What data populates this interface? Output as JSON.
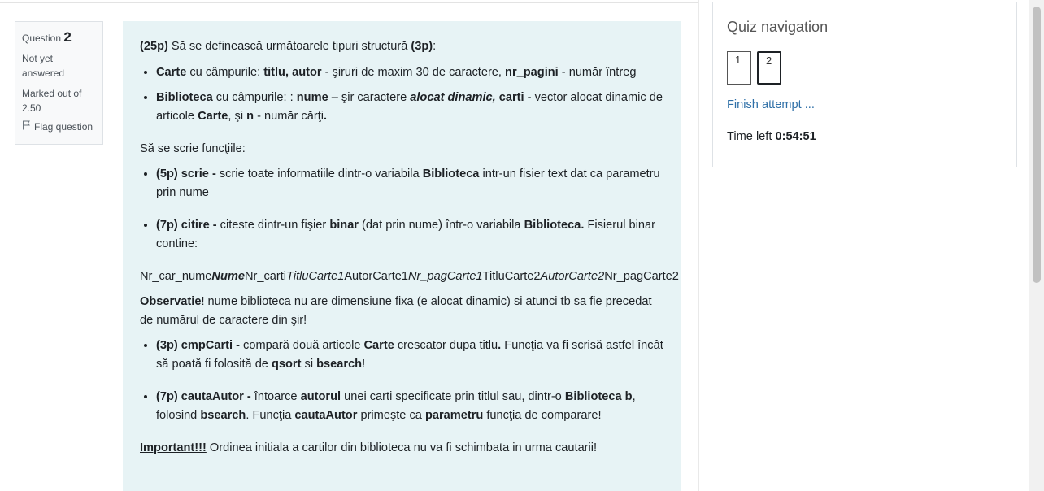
{
  "question_info": {
    "label": "Question",
    "number": "2",
    "state": "Not yet answered",
    "marked_prefix": "Marked out of",
    "marked_value": "2.50",
    "flag_label": "Flag question"
  },
  "question": {
    "intro_points": "(25p)",
    "intro_text": " Să se definească următoarele tipuri structură ",
    "intro_points2": "(3p)",
    "intro_end": ":",
    "struct_items": [
      {
        "b1": "Carte",
        "t1": " cu câmpurile: ",
        "b2": "titlu, autor",
        "t2": " - şiruri de maxim 30 de caractere, ",
        "b3": "nr_pagini",
        "t3": " - număr întreg"
      },
      {
        "b1": "Biblioteca",
        "t1": " cu câmpurile: : ",
        "b2": "nume",
        "t2": " – şir caractere ",
        "bi": "alocat dinamic,",
        "b3": " carti",
        "t3": " - vector alocat dinamic de articole ",
        "b4": "Carte",
        "t4": ", şi ",
        "b5": "n",
        "t5": " - număr cărţi",
        "b6": "."
      }
    ],
    "functions_heading": "Să se scrie funcţiile:",
    "fn1": {
      "b": "(5p) scrie -",
      "t1": " scrie toate informatiile dintr-o variabila ",
      "b2": "Biblioteca",
      "t2": " intr-un fisier text dat ca parametru prin nume"
    },
    "fn2": {
      "b": "(7p) citire -",
      "t1": " citeste dintr-un fişier ",
      "b2": "binar",
      "t2": " (dat prin nume) într-o variabila ",
      "b3": "Biblioteca.",
      "t3": " Fisierul binar contine:"
    },
    "format_line": {
      "p1": "Nr_car_nume",
      "p2": "Nume",
      "p3": "Nr_carti",
      "p4": "TitluCarte1",
      "p5": "AutorCarte1",
      "p6": "Nr_pagCarte1",
      "p7": "TitluCarte2",
      "p8": "AutorCarte2",
      "p9": "Nr_pagCarte2"
    },
    "observatie": {
      "u": "Observatie",
      "t": "! nume biblioteca nu are dimensiune fixa (e alocat dinamic) si atunci tb sa fie precedat de numărul de caractere din şir!"
    },
    "fn3": {
      "b": "(3p) cmpCarti -",
      "t1": " compară două articole ",
      "b2": "Carte",
      "t2": " crescator dupa titlu",
      "b3": ".",
      "t3": " Funcţia va fi scrisă astfel încât să poată fi folosită de ",
      "b4": "qsort",
      "t4": " si ",
      "b5": "bsearch",
      "t5": "!"
    },
    "fn4": {
      "b": "(7p) cautaAutor -",
      "t1": " întoarce ",
      "b2": "autorul",
      "t2": " unei carti specificate prin titlul sau, dintr-o ",
      "b3": "Biblioteca b",
      "t3": ", folosind ",
      "b4": "bsearch",
      "t4": ". Funcţia ",
      "b5": "cautaAutor",
      "t5": " primeşte ca ",
      "b6": "parametru",
      "t6": " funcţia de comparare!"
    },
    "important": {
      "u": "Important!!!",
      "t": " Ordinea initiala a cartilor din biblioteca nu va fi schimbata in urma cautarii!"
    }
  },
  "quiz_nav": {
    "title": "Quiz navigation",
    "buttons": [
      "1",
      "2"
    ],
    "finish_label": "Finish attempt ...",
    "time_label": "Time left ",
    "time_value": "0:54:51"
  }
}
